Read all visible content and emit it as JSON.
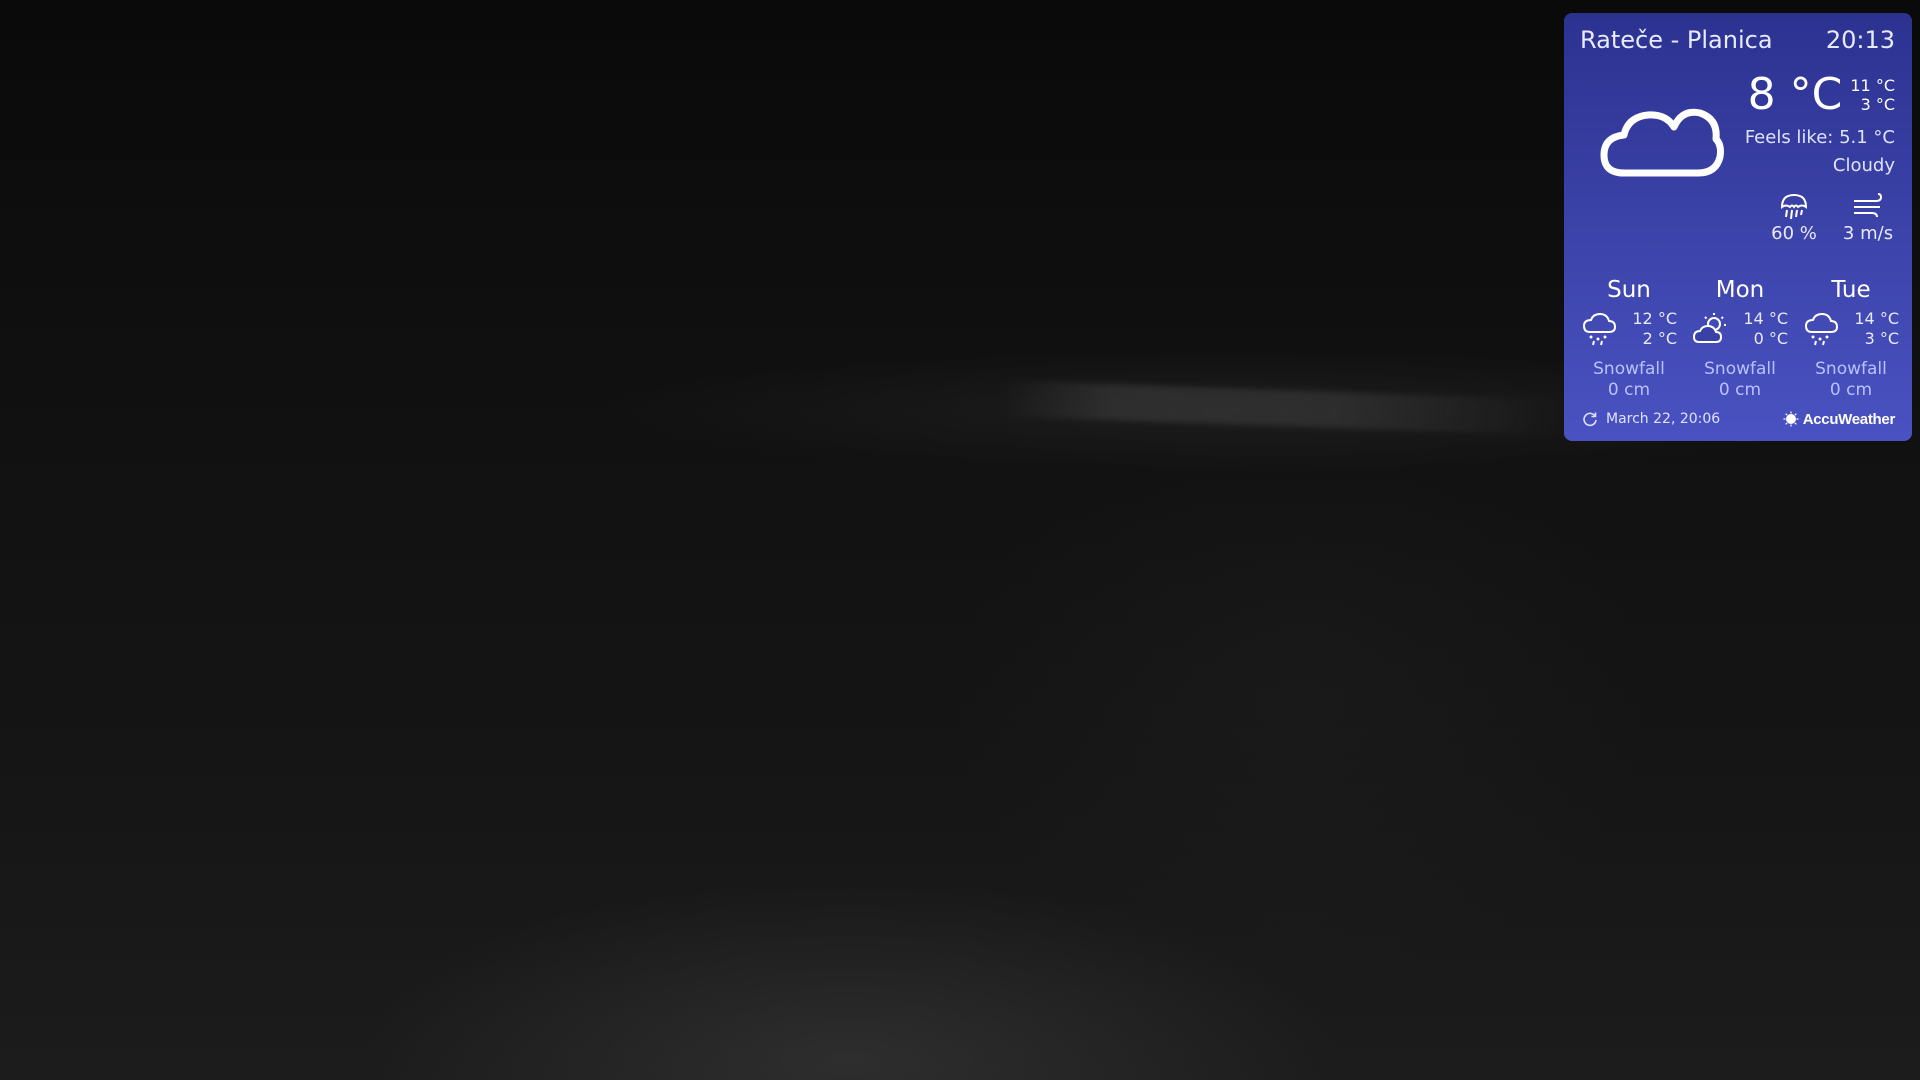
{
  "widget": {
    "location": "Rateče - Planica",
    "time": "20:13",
    "current": {
      "icon": "cloud-icon",
      "temperature": "8 °C",
      "max": "11 °C",
      "min": "3 °C",
      "feels_like": "Feels like: 5.1 °C",
      "condition": "Cloudy",
      "precipitation_icon": "rain-umbrella-icon",
      "precipitation": "60 %",
      "wind_icon": "wind-icon",
      "wind": "3 m/s"
    },
    "forecast": [
      {
        "day": "Sun",
        "icon": "rain-snow-cloud-icon",
        "max": "12 °C",
        "min": "2 °C",
        "snow_label": "Snowfall",
        "snow_amount": "0 cm"
      },
      {
        "day": "Mon",
        "icon": "partly-cloudy-sun-icon",
        "max": "14 °C",
        "min": "0 °C",
        "snow_label": "Snowfall",
        "snow_amount": "0 cm"
      },
      {
        "day": "Tue",
        "icon": "rain-snow-cloud-icon",
        "max": "14 °C",
        "min": "3 °C",
        "snow_label": "Snowfall",
        "snow_amount": "0 cm"
      }
    ],
    "updated": "March 22, 20:06",
    "provider": "AccuWeather"
  },
  "colors": {
    "widget_bg_top": "#2c3290",
    "widget_bg_bottom": "#4a52c2",
    "snow_text": "#b9c2ff"
  }
}
